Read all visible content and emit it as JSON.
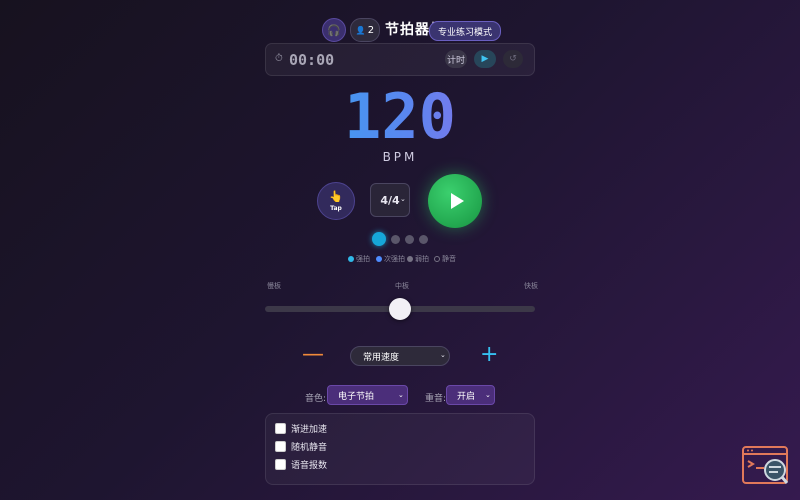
{
  "header": {
    "app_icon": "headphones-icon",
    "count_icon": "user-icon",
    "count_value": "2",
    "title": "节拍器练习",
    "badge": "专业练习模式"
  },
  "timer": {
    "icon": "timer-icon",
    "value": "00:00",
    "buttons": {
      "mode": "计时",
      "start": "▶",
      "reset": "↺"
    }
  },
  "tempo": {
    "bpm": "120",
    "bpm_label": "BPM"
  },
  "controls": {
    "tap_icon": "hand-tap-icon",
    "tap_label": "Tap",
    "time_signature": "4/4",
    "time_signature_options": [
      "4/4"
    ],
    "play_icon": "play-icon"
  },
  "beats": {
    "count": 4,
    "active_index": 0,
    "legend": [
      {
        "label": "强拍",
        "color": "#30b8e8"
      },
      {
        "label": "次强拍",
        "color": "#4e8cff"
      },
      {
        "label": "弱拍",
        "color": "#777385"
      },
      {
        "label": "静音",
        "color": "#777385"
      }
    ]
  },
  "slider": {
    "label_min": "慢板",
    "label_mid": "中板",
    "label_max": "快板",
    "level": 0.5
  },
  "preset": {
    "decrement_icon": "minus-icon",
    "increment_icon": "plus-icon",
    "selected": "常用速度"
  },
  "sound": {
    "label": "音色:",
    "selected": "电子节拍"
  },
  "accent": {
    "label": "重音:",
    "selected": "开启"
  },
  "checklist": {
    "items": [
      {
        "label": "渐进加速",
        "checked": false
      },
      {
        "label": "随机静音",
        "checked": false
      },
      {
        "label": "语音报数",
        "checked": false
      }
    ]
  },
  "corner_widget": {
    "icon": "terminal-search-icon"
  }
}
